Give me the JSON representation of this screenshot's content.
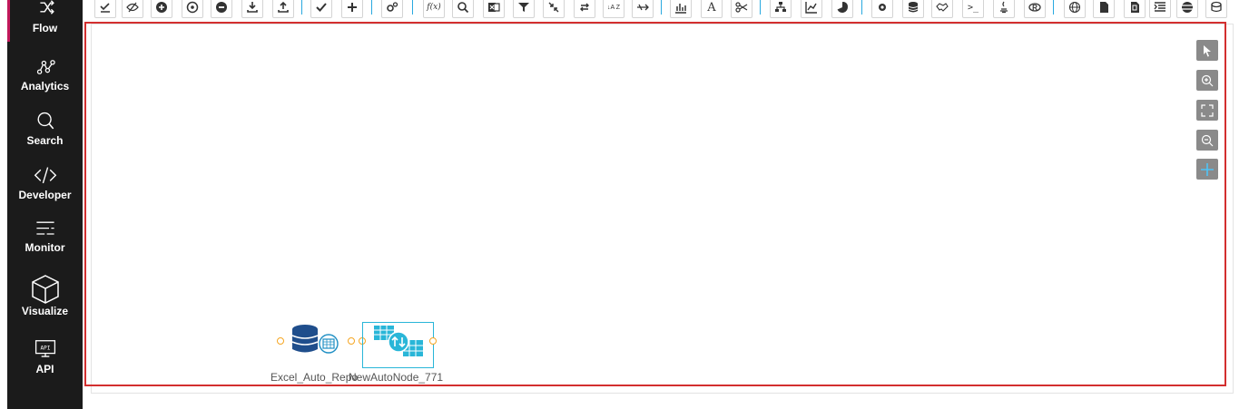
{
  "sidebar": {
    "items": [
      {
        "label": "Flow",
        "icon": "flow-icon"
      },
      {
        "label": "Analytics",
        "icon": "analytics-icon"
      },
      {
        "label": "Search",
        "icon": "search-icon"
      },
      {
        "label": "Developer",
        "icon": "code-icon"
      },
      {
        "label": "Monitor",
        "icon": "monitor-icon"
      },
      {
        "label": "Visualize",
        "icon": "cube-icon"
      },
      {
        "label": "API",
        "icon": "api-icon"
      }
    ]
  },
  "toolbar": {
    "fx_label": "f(x)",
    "font_label": "A",
    "shell_label": ">_",
    "sort_label": "↓A Z"
  },
  "canvas_controls": [
    "pointer-icon",
    "zoom-in-icon",
    "fit-screen-icon",
    "zoom-out-icon",
    "pan-icon"
  ],
  "nodes": [
    {
      "label": "Excel_Auto_Repo",
      "icon": "database-excel-icon"
    },
    {
      "label": "NewAutoNode_771",
      "icon": "table-transform-icon"
    }
  ],
  "colors": {
    "sidebar_bg": "#1b1b1b",
    "active_accent": "#c2185b",
    "canvas_border": "#d32f2f",
    "separator": "#29a9e0",
    "port": "#f5a623",
    "selection": "#29b6d8"
  },
  "api_badge": "API"
}
